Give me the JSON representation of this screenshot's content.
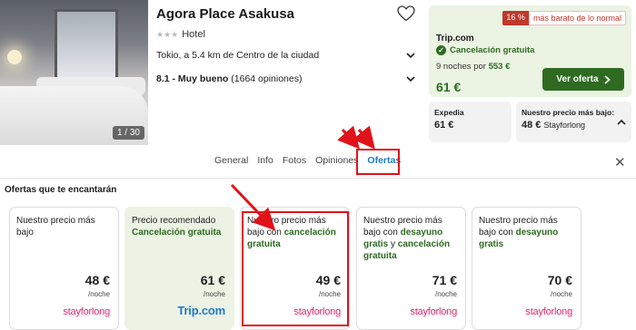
{
  "hotel": {
    "name": "Agora Place Asakusa",
    "stars": "★★★",
    "type": "Hotel",
    "location": "Tokio, a 5.4 km de Centro de la ciudad",
    "rating_score": "8.1 - Muy bueno",
    "rating_reviews": "(1664 opiniones)",
    "photo_counter": "1 / 30"
  },
  "featured_offer": {
    "badge_pct": "16 %",
    "badge_text": "más barato de lo normal",
    "provider": "Trip.com",
    "cancellation": "Cancelación gratuita",
    "nights_text": "9 noches por",
    "nights_price": "553 €",
    "price": "61 €",
    "button": "Ver oferta"
  },
  "small_offers": [
    {
      "label": "Expedia",
      "price": "61 €",
      "provider": ""
    },
    {
      "label": "Nuestro precio más bajo:",
      "price": "48 €",
      "provider": "Stayforlong"
    }
  ],
  "tabs": [
    "General",
    "Info",
    "Fotos",
    "Opiniones",
    "Ofertas"
  ],
  "active_tab": "Ofertas",
  "section_title": "Ofertas que te encantarán",
  "offer_cards": [
    {
      "t1": "Nuestro precio más bajo",
      "t2": "",
      "t3": "",
      "t4": "",
      "price": "48 €",
      "per": "/noche",
      "logo": "stayforlong"
    },
    {
      "t1": "Precio recomendado",
      "t2": "Cancelación gratuita",
      "t3": "",
      "t4": "",
      "price": "61 €",
      "per": "/noche",
      "logo": "Trip.com"
    },
    {
      "t1": "Nuestro precio más bajo con",
      "t2": "cancelación gratuita",
      "t3": "",
      "t4": "",
      "price": "49 €",
      "per": "/noche",
      "logo": "stayforlong"
    },
    {
      "t1": "Nuestro precio más bajo con",
      "t2": "desayuno gratis",
      "t3": " y ",
      "t4": "cancelación gratuita",
      "price": "71 €",
      "per": "/noche",
      "logo": "stayforlong"
    },
    {
      "t1": "Nuestro precio más bajo con",
      "t2": "desayuno gratis",
      "t3": "",
      "t4": "",
      "price": "70 €",
      "per": "/noche",
      "logo": "stayforlong"
    }
  ],
  "colors": {
    "accent_green": "#2e6b21",
    "link_blue": "#1e78c8",
    "annotation_red": "#e0121a",
    "stayforlong_pink": "#e0266b"
  }
}
